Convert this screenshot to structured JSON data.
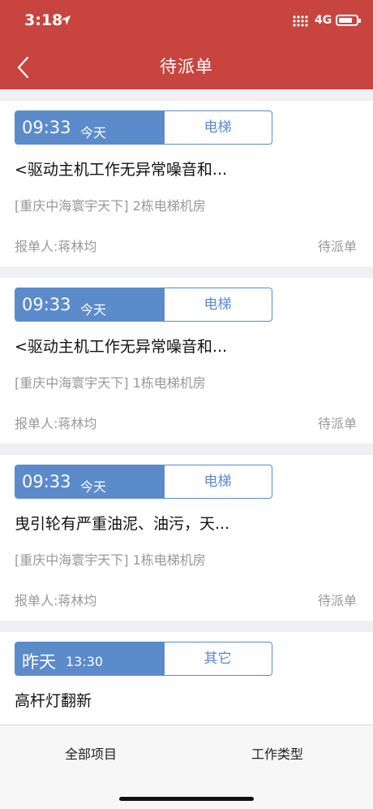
{
  "status_bar": {
    "time": "3:18",
    "network": "4G"
  },
  "nav": {
    "title": "待派单"
  },
  "orders": [
    {
      "time": "09:33",
      "day": "今天",
      "category": "电梯",
      "title": "<驱动主机工作无异常噪音和...",
      "location": "[重庆中海寰宇天下] 2栋电梯机房",
      "reporter": "报单人:蒋林均",
      "status": "待派单"
    },
    {
      "time": "09:33",
      "day": "今天",
      "category": "电梯",
      "title": "<驱动主机工作无异常噪音和...",
      "location": "[重庆中海寰宇天下] 1栋电梯机房",
      "reporter": "报单人:蒋林均",
      "status": "待派单"
    },
    {
      "time": "09:33",
      "day": "今天",
      "category": "电梯",
      "title": "曳引轮有严重油泥、油污，天...",
      "location": "[重庆中海寰宇天下] 1栋电梯机房",
      "reporter": "报单人:蒋林均",
      "status": "待派单"
    },
    {
      "time": "13:30",
      "day": "昨天",
      "category": "其它",
      "title": "高杆灯翻新"
    }
  ],
  "tabs": {
    "all_projects": "全部项目",
    "work_type": "工作类型"
  },
  "colors": {
    "header": "#c8453f",
    "accent": "#5b8bcb"
  }
}
